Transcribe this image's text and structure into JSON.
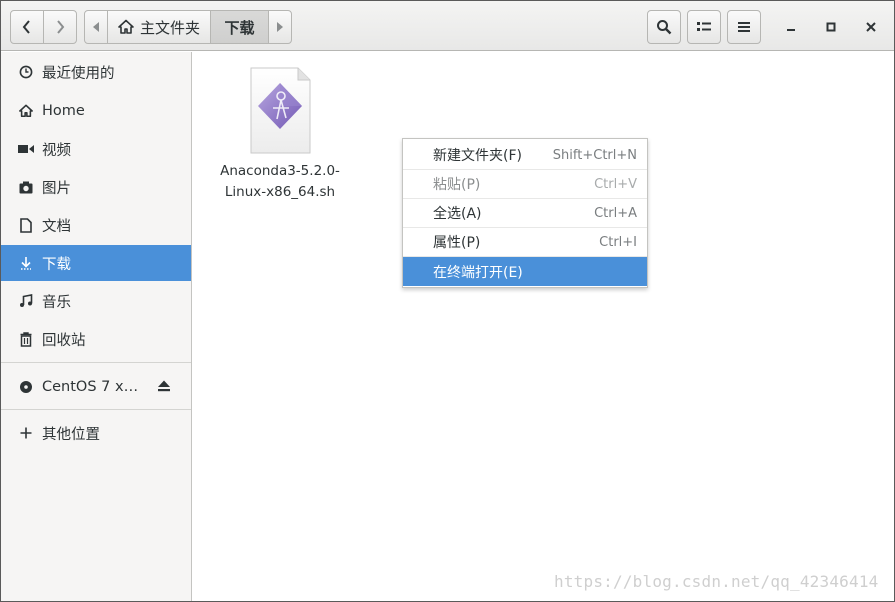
{
  "header": {
    "pathbar": {
      "home_label": "主文件夹",
      "current_label": "下载"
    }
  },
  "sidebar": {
    "items": [
      {
        "label": "最近使用的",
        "icon": "clock-icon"
      },
      {
        "label": "Home",
        "icon": "home-icon"
      },
      {
        "label": "视频",
        "icon": "video-icon"
      },
      {
        "label": "图片",
        "icon": "camera-icon"
      },
      {
        "label": "文档",
        "icon": "document-icon"
      },
      {
        "label": "下载",
        "icon": "download-icon",
        "selected": true
      },
      {
        "label": "音乐",
        "icon": "music-icon"
      },
      {
        "label": "回收站",
        "icon": "trash-icon"
      }
    ],
    "device": {
      "label": "CentOS 7 x…",
      "icon": "disc-icon"
    },
    "other": {
      "label": "其他位置",
      "icon": "plus-icon"
    }
  },
  "files": [
    {
      "name_line1": "Anaconda3-5.2.0-",
      "name_line2": "Linux-x86_64.sh",
      "icon": "script-file-icon"
    }
  ],
  "context_menu": {
    "items": [
      {
        "label": "新建文件夹(F)",
        "accel": "Shift+Ctrl+N",
        "state": "normal"
      },
      {
        "label": "粘贴(P)",
        "accel": "Ctrl+V",
        "state": "disabled"
      },
      {
        "label": "全选(A)",
        "accel": "Ctrl+A",
        "state": "normal"
      },
      {
        "label": "属性(P)",
        "accel": "Ctrl+I",
        "state": "normal"
      },
      {
        "label": "在终端打开(E)",
        "accel": "",
        "state": "highlighted"
      }
    ]
  },
  "watermark": "https://blog.csdn.net/qq_42346414",
  "colors": {
    "accent": "#4a90d9",
    "sidebar_bg": "#f6f5f4",
    "text": "#2e3436"
  }
}
